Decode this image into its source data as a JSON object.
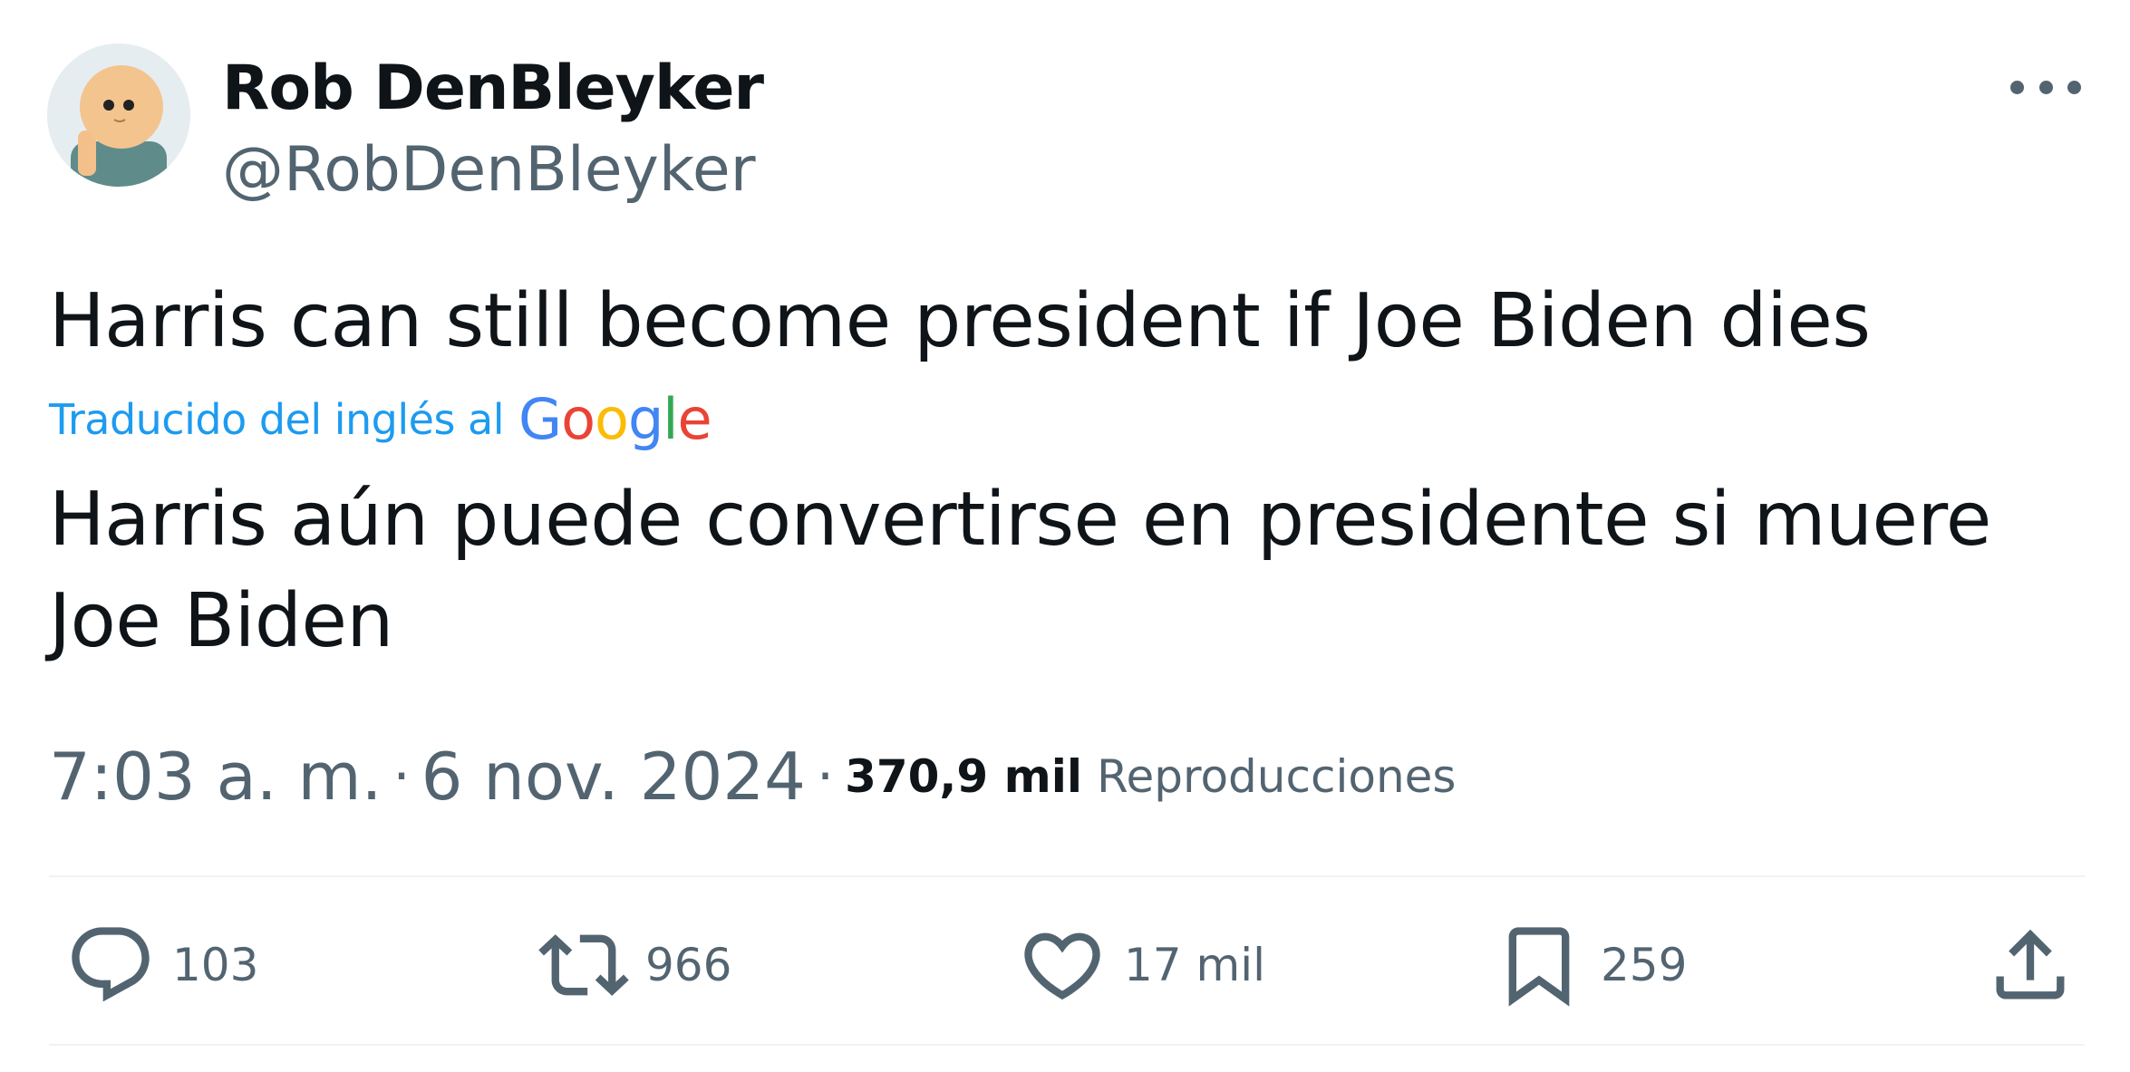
{
  "author": {
    "display_name": "Rob DenBleyker",
    "handle": "@RobDenBleyker"
  },
  "tweet": {
    "text": "Harris can still become president if Joe Biden dies",
    "translation_label": "Traducido del inglés al",
    "translation_provider": "Google",
    "translated_text": "Harris aún puede convertirse en presidente si muere Joe Biden"
  },
  "meta": {
    "time": "7:03 a. m.",
    "separator": "·",
    "date": "6 nov. 2024",
    "views_count": "370,9 mil",
    "views_label": "Reproducciones"
  },
  "actions": {
    "replies": "103",
    "reposts": "966",
    "likes": "17 mil",
    "bookmarks": "259"
  },
  "colors": {
    "text": "#0f1419",
    "secondary": "#536471",
    "link": "#1d9bf0",
    "divider": "#eff3f4",
    "google_blue": "#4285f4",
    "google_red": "#ea4335",
    "google_yellow": "#fbbc05",
    "google_green": "#34a853"
  },
  "icons": {
    "more": "more-horizontal-icon",
    "reply": "reply-bubble-icon",
    "repost": "repost-arrows-icon",
    "like": "heart-icon",
    "bookmark": "bookmark-icon",
    "share": "share-upload-icon"
  }
}
